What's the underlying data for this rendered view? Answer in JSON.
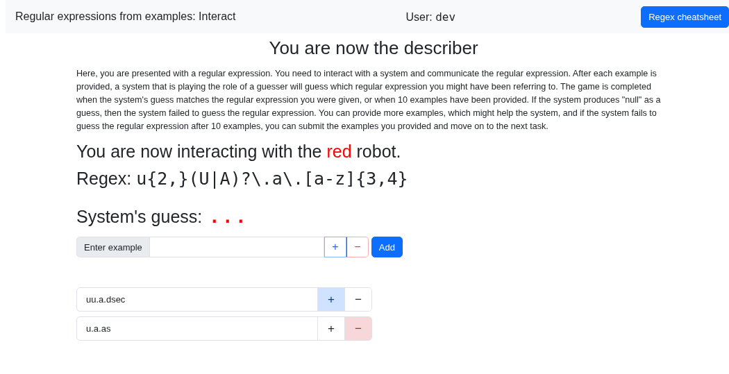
{
  "navbar": {
    "title": "Regular expressions from examples: Interact",
    "user_label": "User:",
    "user_name": "dev",
    "cheatsheet_button": "Regex cheatsheet"
  },
  "heading": "You are now the describer",
  "instructions": "Here, you are presented with a regular expression. You need to interact with a system and communicate the regular expression. After each example is provided, a system that is playing the role of a guesser will guess which regular expression you might have been referring to. The game is completed when the system's guess matches the regular expression you were given, or when 10 examples have been provided. If the system produces \"null\" as a guess, then the system failed to guess the regular expression. You can provide more examples, which might help the system, and if the system fails to guess the regular expression after 10 examples, you can submit the examples you provided and move on to the next task.",
  "robot_line": {
    "before": "You are now interacting with the",
    "robot": "red",
    "after": "robot."
  },
  "regex": {
    "label": "Regex:",
    "pattern": "u{2,}(U|A)?\\.a\\.[a-z]{3,4}"
  },
  "guess": {
    "label": "System's guess:",
    "value": "..."
  },
  "entry": {
    "placeholder": "Enter example",
    "plus": "+",
    "minus": "−",
    "add_button": "Add"
  },
  "examples": [
    {
      "text": "uu.a.dsec",
      "plus": "+",
      "minus": "−",
      "positive": true
    },
    {
      "text": "u.a.as",
      "plus": "+",
      "minus": "−",
      "positive": false
    }
  ]
}
